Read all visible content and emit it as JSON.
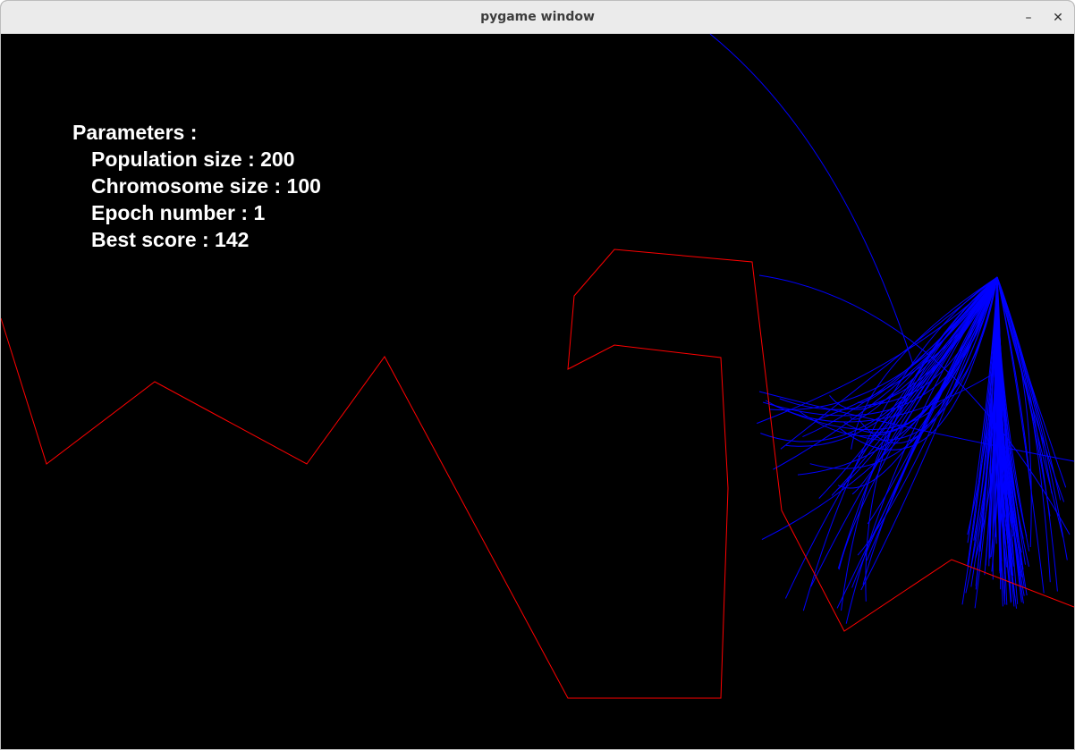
{
  "window": {
    "title": "pygame window",
    "minimize_symbol": "–",
    "close_symbol": "✕"
  },
  "parameters": {
    "heading": "Parameters :",
    "population": "Population size : 200",
    "chromosome": "Chromosome size : 100",
    "epoch": "Epoch number : 1",
    "best_score": "Best score : 142"
  },
  "colors": {
    "background": "#000000",
    "track": "#ff0000",
    "paths": "#0000ff",
    "text": "#ffffff"
  }
}
